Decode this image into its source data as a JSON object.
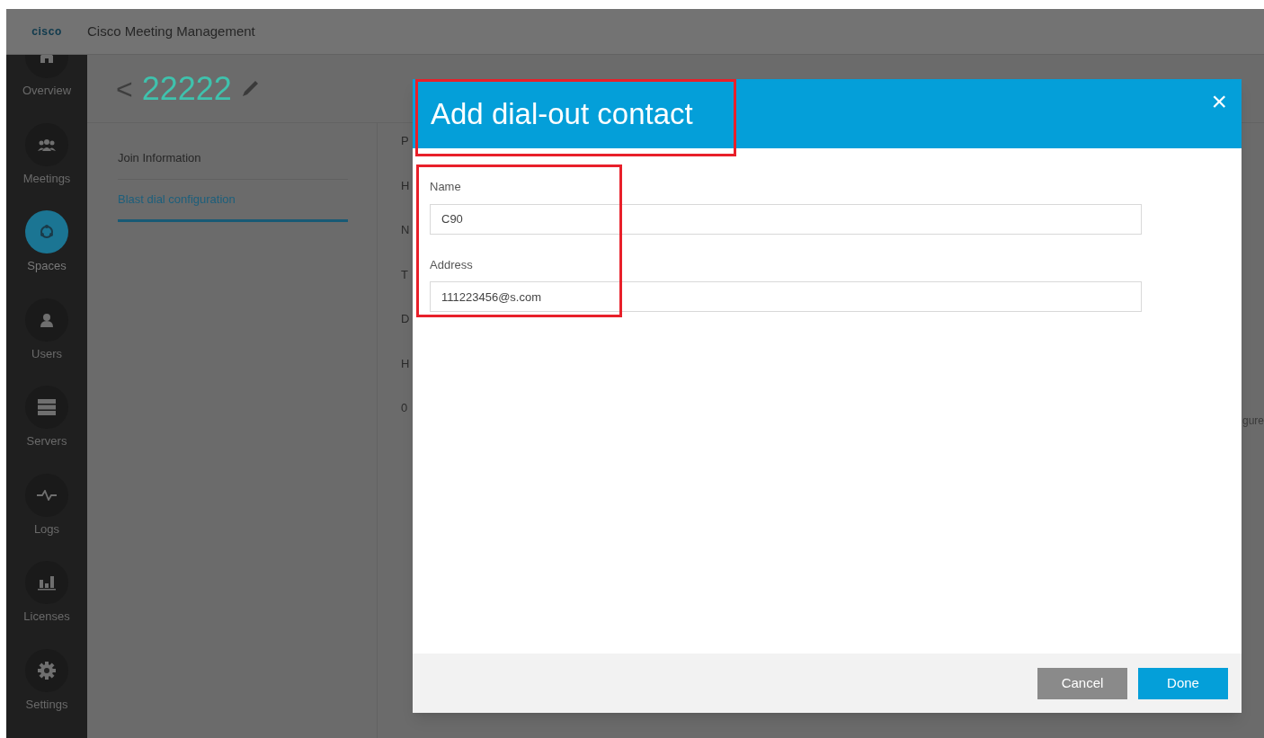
{
  "app": {
    "title": "Cisco Meeting Management",
    "logo": "cisco"
  },
  "sidebar": {
    "items": [
      {
        "label": "Overview",
        "kind": "home",
        "selected": false
      },
      {
        "label": "Meetings",
        "kind": "people",
        "selected": false
      },
      {
        "label": "Spaces",
        "kind": "spaces",
        "selected": true
      },
      {
        "label": "Users",
        "kind": "user",
        "selected": false
      },
      {
        "label": "Servers",
        "kind": "servers",
        "selected": false
      },
      {
        "label": "Logs",
        "kind": "pulse",
        "selected": false
      },
      {
        "label": "Licenses",
        "kind": "chart",
        "selected": false
      },
      {
        "label": "Settings",
        "kind": "gear",
        "selected": false
      }
    ]
  },
  "page": {
    "back": "<",
    "title": "22222",
    "nav": [
      {
        "label": "Join Information",
        "selected": false
      },
      {
        "label": "Blast dial configuration",
        "selected": true
      }
    ],
    "behind_fragments": [
      "P",
      "H",
      "N",
      "T",
      "D",
      "H",
      "0"
    ],
    "behind_right_fragment": "gure"
  },
  "dialog": {
    "title": "Add dial-out contact",
    "close": "×",
    "fields": [
      {
        "label": "Name",
        "value": "C90"
      },
      {
        "label": "Address",
        "value": "111223456@s.com"
      }
    ],
    "buttons": [
      {
        "label": "Cancel",
        "kind": "secondary"
      },
      {
        "label": "Done",
        "kind": "primary"
      }
    ]
  }
}
